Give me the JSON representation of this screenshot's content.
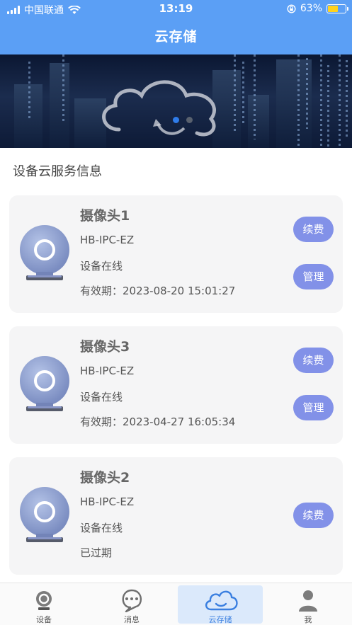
{
  "status_bar": {
    "carrier": "中国联通",
    "time": "13:19",
    "battery": "63%",
    "battery_level": 0.63
  },
  "nav": {
    "title": "云存储"
  },
  "banner": {
    "dots": 3,
    "active_dot": 1
  },
  "section_title": "设备云服务信息",
  "devices": [
    {
      "name": "摄像头1",
      "model": "HB-IPC-EZ",
      "status": "设备在线",
      "expiry": "有效期：2023-08-20 15:01:27",
      "renew_label": "续费",
      "manage_label": "管理"
    },
    {
      "name": "摄像头3",
      "model": "HB-IPC-EZ",
      "status": "设备在线",
      "expiry": "有效期：2023-04-27 16:05:34",
      "renew_label": "续费",
      "manage_label": "管理"
    },
    {
      "name": "摄像头2",
      "model": "HB-IPC-EZ",
      "status": "设备在线",
      "expiry": "已过期",
      "renew_label": "续费"
    }
  ],
  "tabbar": {
    "items": [
      {
        "label": "设备",
        "icon": "camera-icon"
      },
      {
        "label": "消息",
        "icon": "chat-bubble-icon"
      },
      {
        "label": "云存储",
        "icon": "cloud-icon"
      },
      {
        "label": "我",
        "icon": "user-icon"
      }
    ],
    "active_index": 2
  },
  "colors": {
    "header": "#5b9ff5",
    "button": "#8291e8",
    "card": "#f5f5f6",
    "tab_active": "#3a7fe0"
  }
}
